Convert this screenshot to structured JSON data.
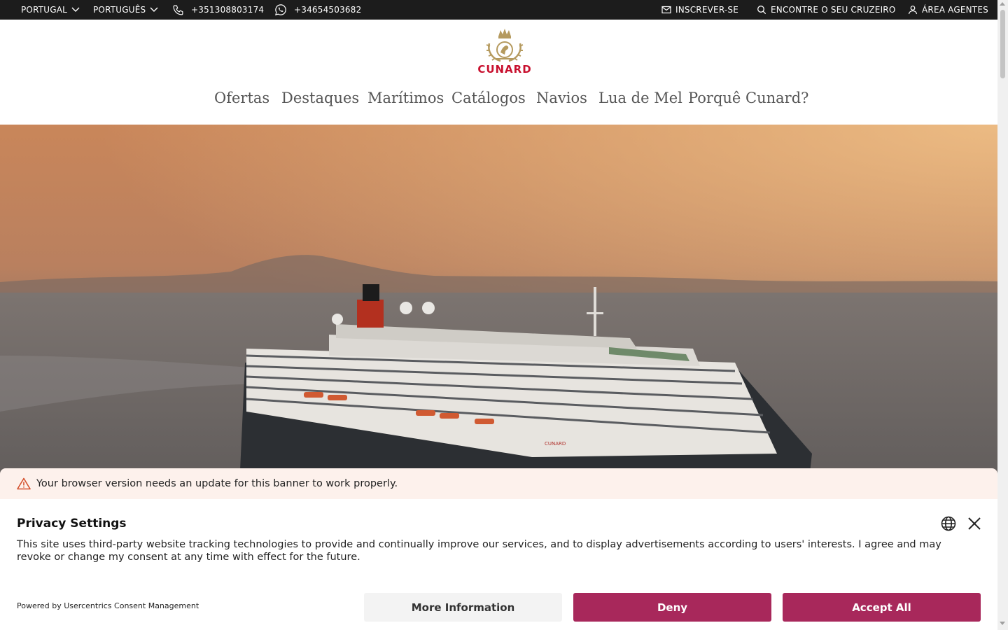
{
  "topbar": {
    "country": "PORTUGAL",
    "language": "PORTUGUÊS",
    "phone": "+351308803174",
    "whatsapp": "+34654503682",
    "subscribe": "INSCREVER-SE",
    "find_cruise": "ENCONTRE O SEU CRUZEIRO",
    "agents": "ÁREA AGENTES"
  },
  "logo": {
    "text": "CUNARD",
    "brand_color": "#c8102e",
    "crest_color": "#b59a5e"
  },
  "nav": {
    "items": [
      "Ofertas",
      "Destaques",
      "Marítimos",
      "Catálogos",
      "Navios",
      "Lua de Mel",
      "Porquê Cunard?"
    ]
  },
  "hero": {
    "ship_name": "CUNARD"
  },
  "warning": {
    "text": "Your browser version needs an update for this banner to work properly."
  },
  "cookie": {
    "title": "Privacy Settings",
    "text": "This site uses third-party website tracking technologies to provide and continually improve our services, and to display advertisements according to users' interests. I agree and may revoke or change my consent at any time with effect for the future.",
    "powered": "Powered by Usercentrics Consent Management",
    "more_label": "More Information",
    "deny_label": "Deny",
    "accept_label": "Accept All",
    "accent_color": "#a8285b"
  }
}
